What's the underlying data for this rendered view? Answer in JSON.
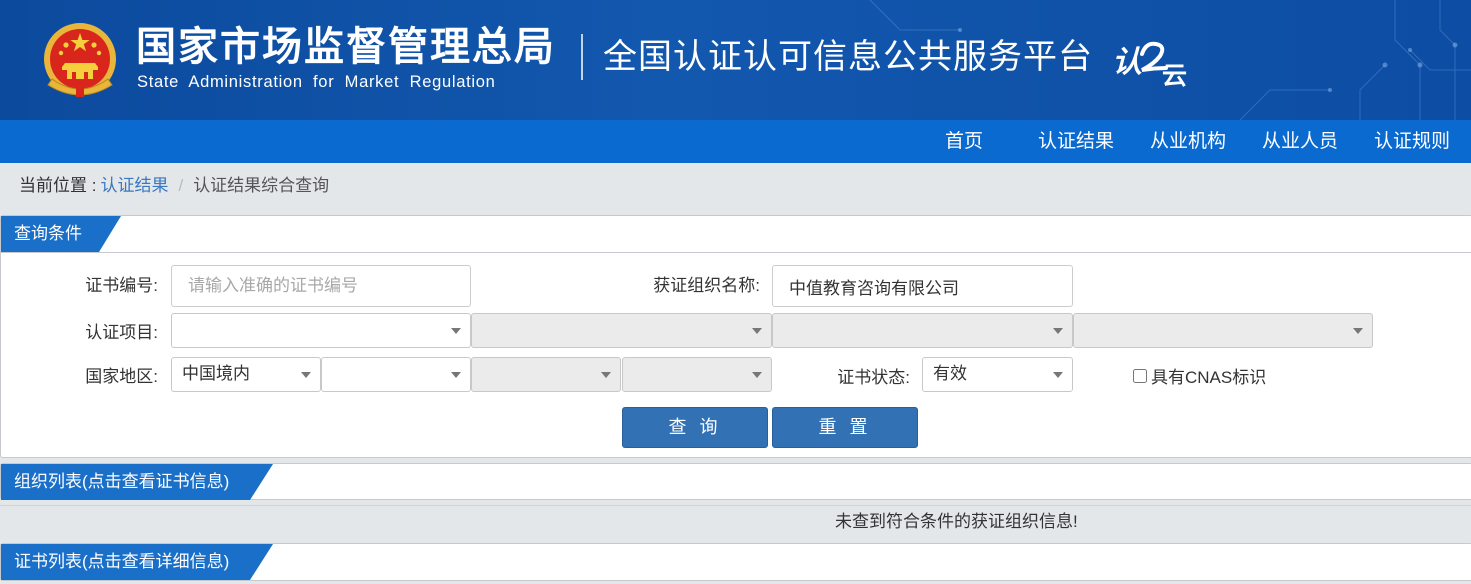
{
  "header": {
    "agency_cn": "国家市场监督管理总局",
    "agency_en": "State Administration for Market Regulation",
    "platform_title": "全国认证认可信息公共服务平台",
    "logo_text_1": "认",
    "logo_text_2": "云"
  },
  "nav": {
    "items": [
      "首页",
      "认证结果",
      "从业机构",
      "从业人员",
      "认证规则"
    ]
  },
  "breadcrumb": {
    "prefix": "当前位置 :",
    "link": "认证结果",
    "separator": "/",
    "current": "认证结果综合查询"
  },
  "query_panel": {
    "title": "查询条件",
    "cert_no_label": "证书编号:",
    "cert_no_placeholder": "请输入准确的证书编号",
    "org_name_label": "获证组织名称:",
    "org_name_value": "中值教育咨询有限公司",
    "project_label": "认证项目:",
    "region_label": "国家地区:",
    "region_value": "中国境内",
    "status_label": "证书状态:",
    "status_value": "有效",
    "cnas_label": "具有CNAS标识",
    "cnas_checked": false,
    "search_button": "查 询",
    "reset_button": "重 置"
  },
  "org_list": {
    "title": "组织列表(点击查看证书信息)",
    "empty_message": "未查到符合条件的获证组织信息!"
  },
  "cert_list": {
    "title": "证书列表(点击查看详细信息)"
  },
  "colors": {
    "banner": "#0c4a9d",
    "nav": "#0b6acf",
    "tab": "#1a6fc9",
    "button": "#3171b4",
    "link": "#3a78c0",
    "page_bg": "#e4e7ea"
  }
}
